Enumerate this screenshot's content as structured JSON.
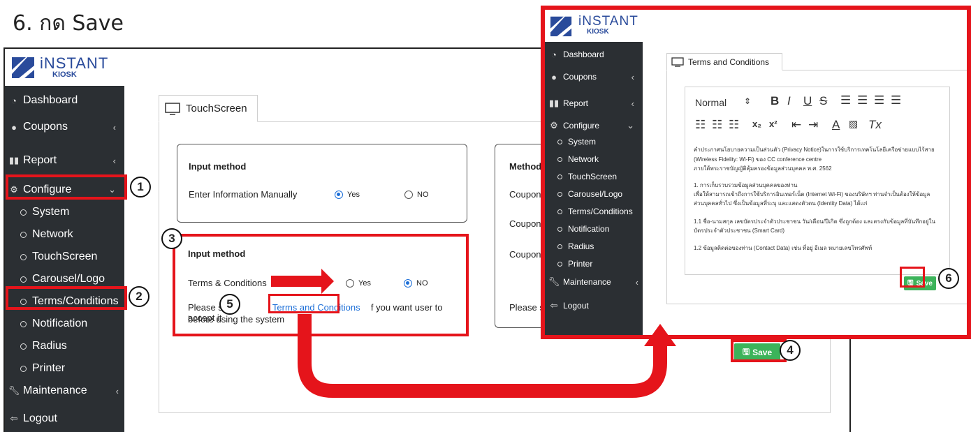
{
  "step_title": "6. กด Save",
  "left": {
    "logo": {
      "brand": "iNSTANT",
      "sub": "KIOSK"
    },
    "sidebar": {
      "dashboard": "Dashboard",
      "coupons": "Coupons",
      "report": "Report",
      "configure": "Configure",
      "subitems": [
        "System",
        "Network",
        "TouchScreen",
        "Carousel/Logo",
        "Terms/Conditions",
        "Notification",
        "Radius",
        "Printer"
      ],
      "maintenance": "Maintenance",
      "logout": "Logout"
    },
    "tab_label": "TouchScreen",
    "box1": {
      "title": "Input method",
      "row_label": "Enter Information Manually",
      "yes": "Yes",
      "no": "NO",
      "selected": "Yes"
    },
    "box2": {
      "title": "Input method",
      "row_label": "Terms & Conditions",
      "yes": "Yes",
      "no": "NO",
      "selected": "NO",
      "text_before": "Please s",
      "link": "Terms and Conditions",
      "text_after": "f you want user to accept it",
      "text_line2": "before using the system"
    },
    "box3": {
      "title": "Method",
      "rows": [
        "Coupon",
        "Coupon",
        "Coupon"
      ],
      "bottom": "Please s"
    },
    "save_label": "Save"
  },
  "right": {
    "logo": {
      "brand": "iNSTANT",
      "sub": "KIOSK"
    },
    "sidebar": {
      "dashboard": "Dashboard",
      "coupons": "Coupons",
      "report": "Report",
      "configure": "Configure",
      "subitems": [
        "System",
        "Network",
        "TouchScreen",
        "Carousel/Logo",
        "Terms/Conditions",
        "Notification",
        "Radius",
        "Printer"
      ],
      "maintenance": "Maintenance",
      "logout": "Logout"
    },
    "tab_label": "Terms and Conditions",
    "toolbar": {
      "format": "Normal",
      "bold": "B",
      "italic": "I",
      "underline": "U",
      "strike": "S",
      "sub": "x₂",
      "sup": "x²",
      "clear": "Tx"
    },
    "content": [
      "คำประกาศนโยบายความเป็นส่วนตัว (Privacy Notice)ในการใช้บริการเทคโนโลยีเครือข่ายแบบไร้สาย",
      "(Wireless Fidelity: Wi-Fi) ของ  CC conference centre",
      "ภายใต้พระราชบัญญัติคุ้มครองข้อมูลส่วนบุคคล พ.ศ. 2562",
      "1. การเก็บรวบรวมข้อมูลส่วนบุคคลของท่าน",
      "เพื่อให้สามารถเข้าถึงการใช้บริการอินเทอร์เน็ต (Internet Wi-Fi) ของบริษัทฯ ท่านจำเป็นต้องให้ข้อมูล",
      "ส่วนบุคคลทั่วไป ซึ่งเป็นข้อมูลที่ระบุ และแสดงตัวตน (Identity Data)  ได้แก่",
      "1.1 ชื่อ-นามสกุล เลขบัตรประจำตัวประชาชน วัน/เดือน/ปีเกิด ซึ่งถูกต้อง และตรงกับข้อมูลที่บันทึกอยู่ใน",
      "บัตรประจำตัวประชาชน (Smart Card)",
      "1.2 ข้อมูลติดต่อของท่าน (Contact Data) เช่น ที่อยู่ อีเมล หมายเลขโทรศัพท์"
    ],
    "save_label": "Save"
  },
  "badges": [
    "1",
    "2",
    "3",
    "4",
    "5",
    "6"
  ],
  "colors": {
    "highlight": "#e5141b",
    "sidebar": "#2b2f33",
    "save": "#3cb35a",
    "link": "#1d6fd8"
  }
}
